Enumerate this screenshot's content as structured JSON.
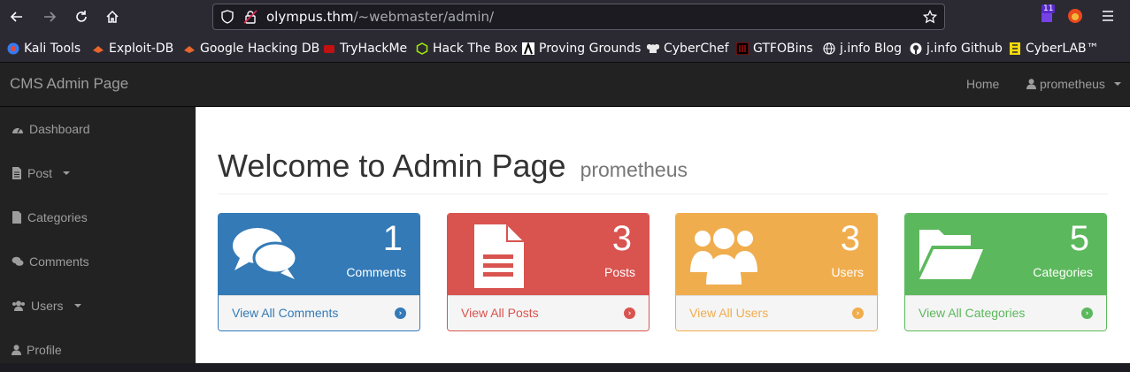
{
  "browser": {
    "url_host": "olympus.thm",
    "url_path": "/~webmaster/admin/",
    "extension_badge": "11"
  },
  "bookmarks": [
    {
      "label": "Kali Tools",
      "icon": "kali-icon"
    },
    {
      "label": "Exploit-DB",
      "icon": "exploit-db-icon"
    },
    {
      "label": "Google Hacking DB",
      "icon": "ghdb-icon"
    },
    {
      "label": "TryHackMe",
      "icon": "tryhackme-icon"
    },
    {
      "label": "Hack The Box",
      "icon": "htb-icon"
    },
    {
      "label": "Proving Grounds",
      "icon": "proving-grounds-icon"
    },
    {
      "label": "CyberChef",
      "icon": "cyberchef-icon"
    },
    {
      "label": "GTFOBins",
      "icon": "gtfobins-icon"
    },
    {
      "label": "j.info Blog",
      "icon": "globe-icon"
    },
    {
      "label": "j.info Github",
      "icon": "github-icon"
    },
    {
      "label": "CyberLAB™",
      "icon": "cyberlab-icon"
    }
  ],
  "topnav": {
    "brand": "CMS Admin Page",
    "home": "Home",
    "user": "prometheus"
  },
  "sidebar": {
    "items": [
      {
        "label": "Dashboard",
        "icon": "dashboard-icon"
      },
      {
        "label": "Post",
        "icon": "file-icon"
      },
      {
        "label": "Categories",
        "icon": "file-icon"
      },
      {
        "label": "Comments",
        "icon": "comments-icon"
      },
      {
        "label": "Users",
        "icon": "users-icon"
      },
      {
        "label": "Profile",
        "icon": "user-icon"
      }
    ]
  },
  "main": {
    "title": "Welcome to Admin Page",
    "subtitle": "prometheus",
    "panels": [
      {
        "count": "1",
        "label": "Comments",
        "link": "View All Comments",
        "color": "#337ab7"
      },
      {
        "count": "3",
        "label": "Posts",
        "link": "View All Posts",
        "color": "#d9534f"
      },
      {
        "count": "3",
        "label": "Users",
        "link": "View All Users",
        "color": "#f0ad4e"
      },
      {
        "count": "5",
        "label": "Categories",
        "link": "View All Categories",
        "color": "#5cb85c"
      }
    ]
  }
}
